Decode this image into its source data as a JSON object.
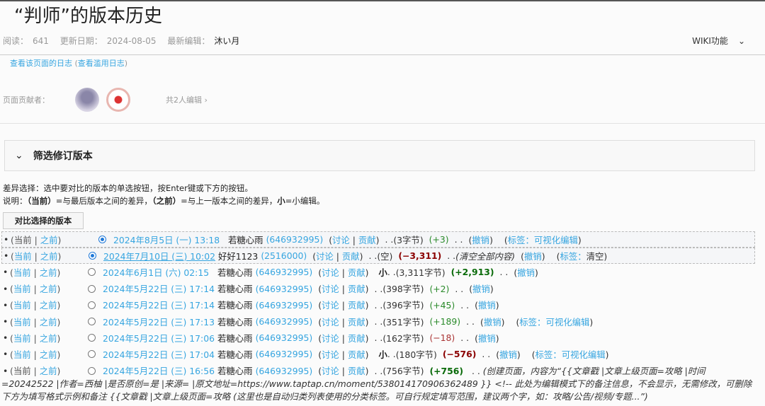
{
  "title": "“判师”的版本历史",
  "meta": {
    "reads_label": "阅读：",
    "reads": "641",
    "updated_label": "更新日期：",
    "updated": "2024-08-05",
    "editor_label": "最新编辑：",
    "editor": "沐い月"
  },
  "wiki_menu": "WIKI功能",
  "log_link": "查看该页面的日志",
  "abuse_log_link": "查看滥用日志",
  "contributors_label": "页面贡献者：",
  "contributors_count": "共2人编辑",
  "filter_title": "筛选修订版本",
  "help": {
    "line1": "差异选择：选中要对比的版本的单选按钮，按Enter键或下方的按钮。",
    "line2_prefix": "说明：",
    "cur": "（当前）",
    "cur_desc": "=与最后版本之间的差异，",
    "prev": "（之前）",
    "prev_desc": "=与上一版本之间的差异，",
    "minor": "小",
    "minor_desc": "=小编辑。"
  },
  "compare_button": "对比选择的版本",
  "labels": {
    "cur": "当前",
    "prev": "之前",
    "talk": "讨论",
    "contribs": "贡献",
    "undo": "撤销",
    "tag": "标签：",
    "minor": "小"
  },
  "revisions": [
    {
      "date": "2024年8月5日 (一) 13:18",
      "user": "若糖心雨",
      "uid": "(646932995)",
      "size": "(3字节)",
      "diff": "(+3)",
      "diff_class": "pos",
      "tag": "可视化编辑",
      "tag_link": true,
      "radio": "on",
      "cur_link": false,
      "sel": true
    },
    {
      "date": "2024年7月10日 (三) 10:02",
      "user": "好好1123",
      "uid": "(2516000)",
      "size": "(空)",
      "diff": "(−3,311)",
      "diff_class": "negb",
      "summary": "(清空全部内容)",
      "tag": "清空",
      "tag_link": false,
      "radio": "on",
      "cur_link": true,
      "sel": true,
      "underline": true
    },
    {
      "date": "2024年6月1日 (六) 02:15",
      "user": "若糖心雨",
      "uid": "(646932995)",
      "minor": true,
      "size": "(3,311字节)",
      "diff": "(+2,913)",
      "diff_class": "posb",
      "radio": "off",
      "cur_link": true
    },
    {
      "date": "2024年5月22日 (三) 17:14",
      "user": "若糖心雨",
      "uid": "(646932995)",
      "size": "(398字节)",
      "diff": "(+2)",
      "diff_class": "pos",
      "radio": "off",
      "cur_link": true
    },
    {
      "date": "2024年5月22日 (三) 17:14",
      "user": "若糖心雨",
      "uid": "(646932995)",
      "size": "(396字节)",
      "diff": "(+45)",
      "diff_class": "pos",
      "radio": "off",
      "cur_link": true
    },
    {
      "date": "2024年5月22日 (三) 17:13",
      "user": "若糖心雨",
      "uid": "(646932995)",
      "size": "(351字节)",
      "diff": "(+189)",
      "diff_class": "pos",
      "tag": "可视化编辑",
      "tag_link": true,
      "radio": "off",
      "cur_link": true
    },
    {
      "date": "2024年5月22日 (三) 17:06",
      "user": "若糖心雨",
      "uid": "(646932995)",
      "size": "(162字节)",
      "diff": "(−18)",
      "diff_class": "neg",
      "radio": "off",
      "cur_link": true
    },
    {
      "date": "2024年5月22日 (三) 17:04",
      "user": "若糖心雨",
      "uid": "(646932995)",
      "minor": true,
      "size": "(180字节)",
      "diff": "(−576)",
      "diff_class": "negb",
      "tag": "可视化编辑",
      "tag_link": true,
      "radio": "off",
      "cur_link": true
    }
  ],
  "first_revision": {
    "date": "2024年5月22日 (三) 16:56",
    "user": "若糖心雨",
    "uid": "(646932995)",
    "size": "(756字节)",
    "diff": "(+756)",
    "summary": "(创建页面，内容为“{{文章戳 |文章上级页面=攻略 |时间=20242522 |作者=西柚 |是否原创=是 |来源= |原文地址=https://www.taptap.cn/moment/538014170906362489 }} <!-- 此处为编辑模式下的备注信息，不会显示，无需修改，可删除下方为填写格式示例和备注 {{文章戳 |文章上级页面=攻略 (这里也是自动归类列表使用的分类标签。可自行规定填写范围，建议两个字，如：攻略/公告/视频/专题...”)"
  }
}
